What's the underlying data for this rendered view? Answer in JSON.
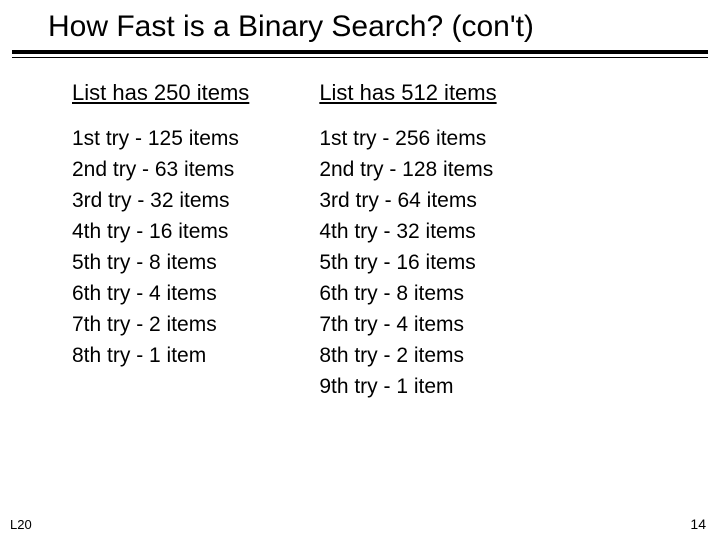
{
  "title": "How Fast is a Binary Search? (con't)",
  "footer_left": "L20",
  "footer_right": "14",
  "left": {
    "header": "List has 250 items",
    "items": [
      "1st try - 125 items",
      "2nd try - 63 items",
      "3rd try - 32 items",
      "4th try - 16 items",
      "5th try - 8 items",
      "6th try - 4 items",
      "7th try - 2 items",
      "8th try - 1 item"
    ]
  },
  "right": {
    "header": "List has 512 items",
    "items": [
      "1st try - 256 items",
      "2nd try - 128 items",
      "3rd try - 64 items",
      "4th try - 32 items",
      "5th try - 16 items",
      "6th try - 8 items",
      "7th try - 4 items",
      "8th try - 2 items",
      "9th try - 1 item"
    ]
  }
}
